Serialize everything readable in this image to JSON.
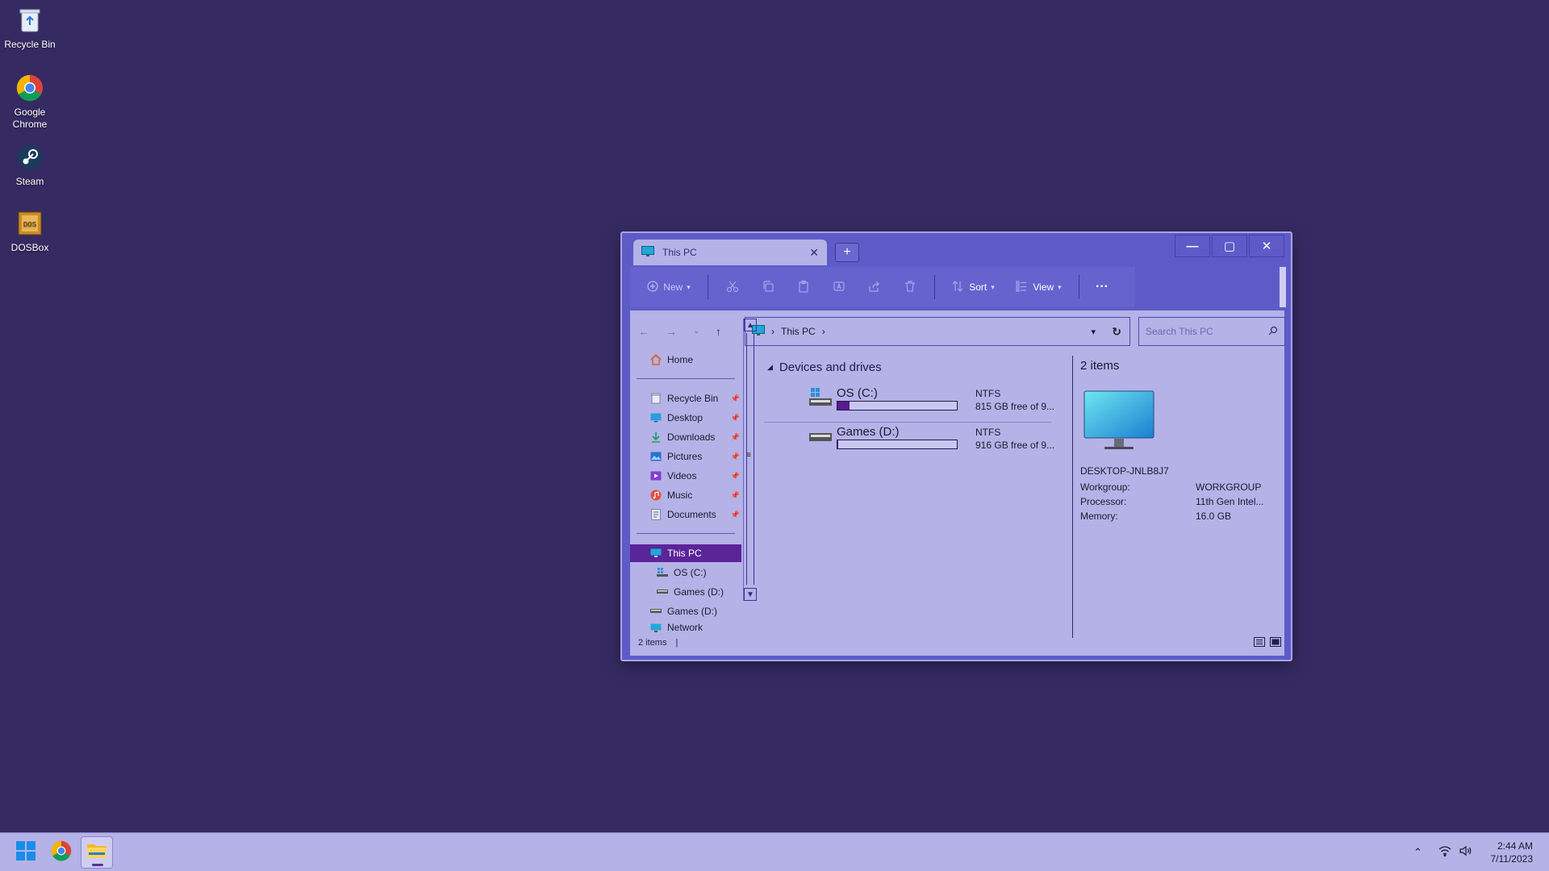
{
  "desktop": {
    "icons": [
      {
        "label": "Recycle Bin",
        "icon": "recycle-bin-icon"
      },
      {
        "label": "Google Chrome",
        "icon": "chrome-icon"
      },
      {
        "label": "Steam",
        "icon": "steam-icon"
      },
      {
        "label": "DOSBox",
        "icon": "dosbox-icon"
      }
    ]
  },
  "explorer": {
    "tab_title": "This PC",
    "tab_close": "✕",
    "new_tab": "+",
    "caption": {
      "minimize": "—",
      "maximize": "▢",
      "close": "✕"
    },
    "toolbar": {
      "new_label": "New",
      "sort_label": "Sort",
      "view_label": "View",
      "more_label": "···"
    },
    "address": {
      "segment": "This PC",
      "chevron": "›"
    },
    "search": {
      "placeholder": "Search This PC"
    },
    "nav": {
      "home": "Home",
      "quick": [
        {
          "label": "Recycle Bin",
          "icon": "recycle-bin-icon"
        },
        {
          "label": "Desktop",
          "icon": "desktop-icon"
        },
        {
          "label": "Downloads",
          "icon": "downloads-icon"
        },
        {
          "label": "Pictures",
          "icon": "pictures-icon"
        },
        {
          "label": "Videos",
          "icon": "videos-icon"
        },
        {
          "label": "Music",
          "icon": "music-icon"
        },
        {
          "label": "Documents",
          "icon": "documents-icon"
        }
      ],
      "this_pc": "This PC",
      "os_c": "OS (C:)",
      "games_d_child": "Games (D:)",
      "games_d": "Games (D:)",
      "network": "Network"
    },
    "group_header": "Devices and drives",
    "drives": [
      {
        "name": "OS (C:)",
        "fs": "NTFS",
        "free": "815 GB free of 9...",
        "used_fraction": 0.1
      },
      {
        "name": "Games (D:)",
        "fs": "NTFS",
        "free": "916 GB free of 9...",
        "used_fraction": 0.01
      }
    ],
    "details": {
      "count": "2 items",
      "computer_name": "DESKTOP-JNLB8J7",
      "rows": [
        {
          "key": "Workgroup:",
          "value": "WORKGROUP"
        },
        {
          "key": "Processor:",
          "value": "11th Gen Intel..."
        },
        {
          "key": "Memory:",
          "value": "16.0 GB"
        }
      ]
    },
    "status": "2 items"
  },
  "taskbar": {
    "time": "2:44 AM",
    "date": "7/11/2023"
  },
  "colors": {
    "desktop": "#352b62",
    "window": "#5e5bc8",
    "pane": "#b4b2e6",
    "accent": "#5b2499"
  }
}
